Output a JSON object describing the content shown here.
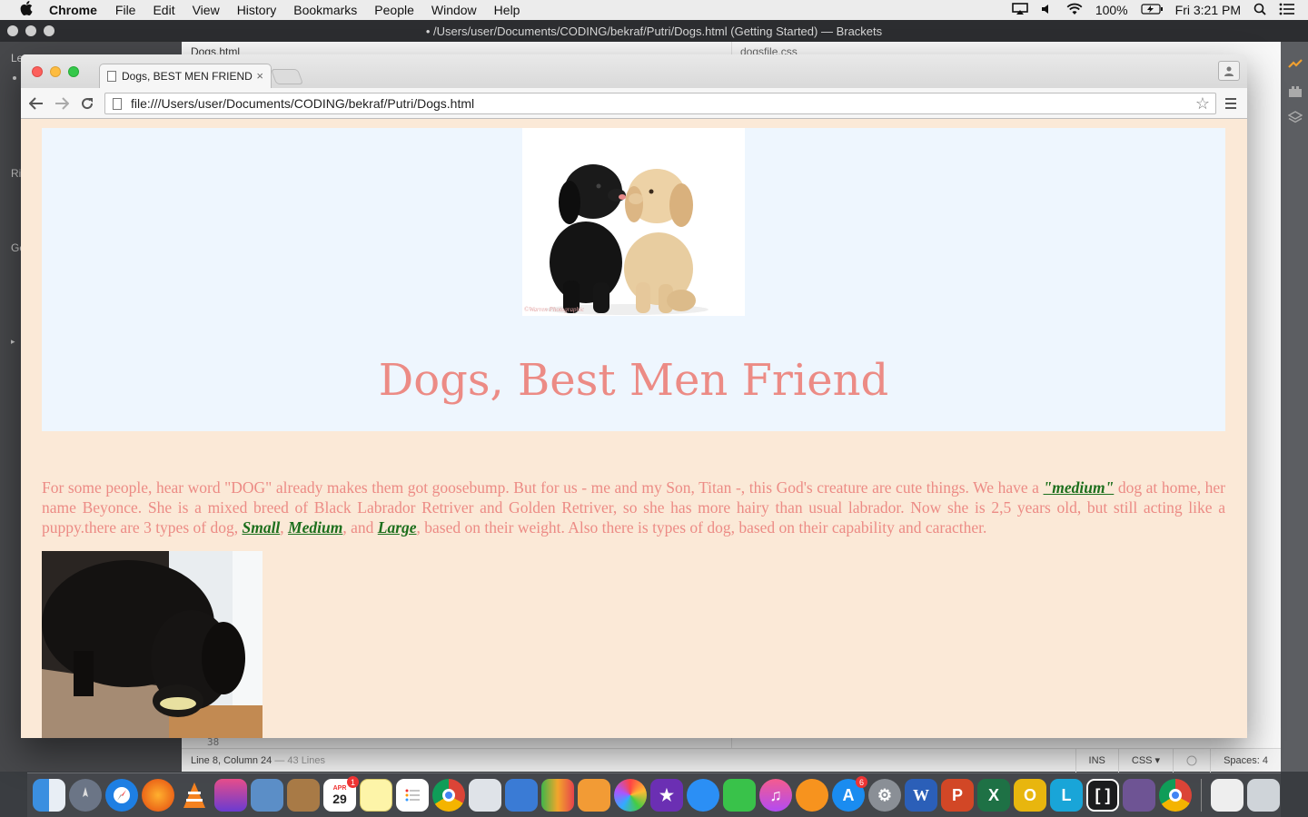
{
  "menubar": {
    "apple": "",
    "app_name": "Chrome",
    "items": [
      "File",
      "Edit",
      "View",
      "History",
      "Bookmarks",
      "People",
      "Window",
      "Help"
    ],
    "battery": "100%",
    "clock": "Fri 3:21 PM"
  },
  "brackets": {
    "title": "• /Users/user/Documents/CODING/bekraf/Putri/Dogs.html (Getting Started) — Brackets",
    "sidebar_labels": [
      "Le",
      "Ri",
      "Ge"
    ],
    "tab_left": "Dogs.html",
    "tab_right": "dogsfile.css",
    "line_number": "38",
    "status_position": "Line 8, Column 24",
    "status_lines": "— 43 Lines",
    "status_mode": "INS",
    "status_lang": "CSS ▾",
    "status_spaces": "Spaces: 4"
  },
  "chrome": {
    "tab_title": "Dogs, BEST MEN FRIEND",
    "tab_close": "×",
    "url": "file:///Users/user/Documents/CODING/bekraf/Putri/Dogs.html"
  },
  "page": {
    "heading": "Dogs, Best Men Friend",
    "intro_part1": "For some people, hear word \"DOG\" already makes them got goosebump. But for us - me and my Son, Titan -, this God's creature are cute things. We have a ",
    "link_medium_quoted": "\"medium\"",
    "intro_part2": " dog at home, her name Beyonce. She is a mixed breed of Black Labrador Retriver and Golden Retriver, so she has more hairy than usual labrador. Now she is 2,5 years old, but still acting like a puppy.there are 3 types of dog, ",
    "link_small": "Small",
    "sep1": ", ",
    "link_medium": "Medium",
    "sep2": ", and ",
    "link_large": "Large",
    "intro_part3": ", based on their weight. Also there is types of dog, based on their capability and caracther.",
    "puppies_watermark": "©Warren Photographic"
  },
  "dock": {
    "calendar_month": "APR",
    "calendar_day": "29",
    "calendar_badge": "1",
    "appstore_badge": "6",
    "word_letter": "W",
    "ppt_letter": "P",
    "excel_letter": "X",
    "outlook_letter": "O",
    "lync_letter": "L"
  }
}
